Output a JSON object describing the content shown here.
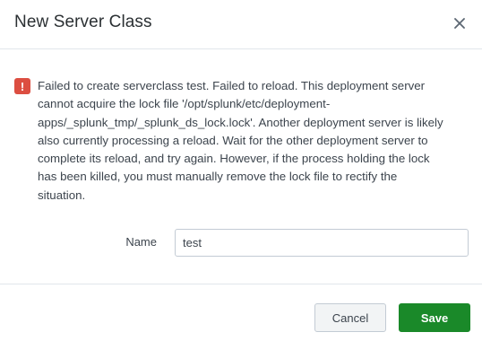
{
  "dialog": {
    "title": "New Server Class",
    "close_icon": "close-icon"
  },
  "alert": {
    "type": "error",
    "icon": "error-exclamation-icon",
    "icon_glyph": "!",
    "icon_color": "#dc4e41",
    "message": "Failed to create serverclass test. Failed to reload. This deployment server cannot acquire the lock file '/opt/splunk/etc/deployment-apps/_splunk_tmp/_splunk_ds_lock.lock'. Another deployment server is likely also currently processing a reload. Wait for the other deployment server to complete its reload, and try again. However, if the process holding the lock has been killed, you must manually remove the lock file to rectify the situation."
  },
  "form": {
    "name_label": "Name",
    "name_value": "test"
  },
  "footer": {
    "cancel_label": "Cancel",
    "save_label": "Save",
    "save_color": "#1a8929"
  }
}
